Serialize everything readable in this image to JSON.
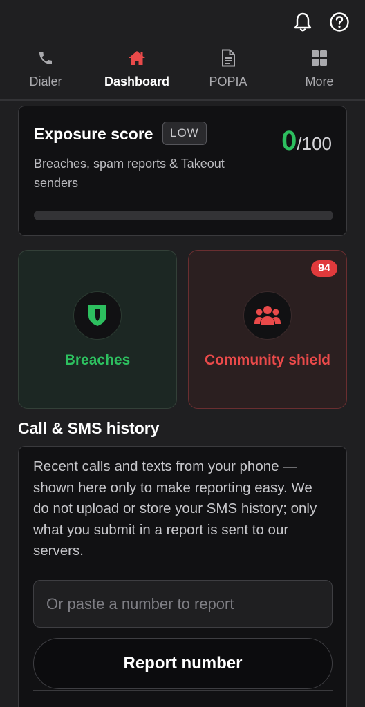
{
  "topbar": {
    "icons": [
      "bell-icon",
      "help-icon"
    ]
  },
  "tabs": [
    {
      "label": "Dialer",
      "icon": "phone-icon",
      "active": false
    },
    {
      "label": "Dashboard",
      "icon": "home-icon",
      "active": true
    },
    {
      "label": "POPIA",
      "icon": "document-icon",
      "active": false
    },
    {
      "label": "More",
      "icon": "grid-icon",
      "active": false
    }
  ],
  "exposure": {
    "title": "Exposure score",
    "level": "LOW",
    "score": "0",
    "score_max": "/100",
    "subtitle": "Breaches, spam reports & Takeout senders",
    "progress_fraction": 0
  },
  "tiles": {
    "breaches": {
      "label": "Breaches",
      "icon": "shield-icon"
    },
    "community": {
      "label": "Community shield",
      "icon": "group-icon",
      "badge": "94"
    }
  },
  "history": {
    "title": "Call & SMS history",
    "description": "Recent calls and texts from your phone — shown here only to make reporting easy. We do not upload or store your SMS history; only what you submit in a report is sent to our servers.",
    "input_placeholder": "Or paste a number to report",
    "input_value": "",
    "button_label": "Report number"
  },
  "colors": {
    "accent_green": "#2dbf5f",
    "accent_red": "#ea4a4a",
    "active_tab_icon": "#e84a4a",
    "background": "#1f1f21"
  }
}
